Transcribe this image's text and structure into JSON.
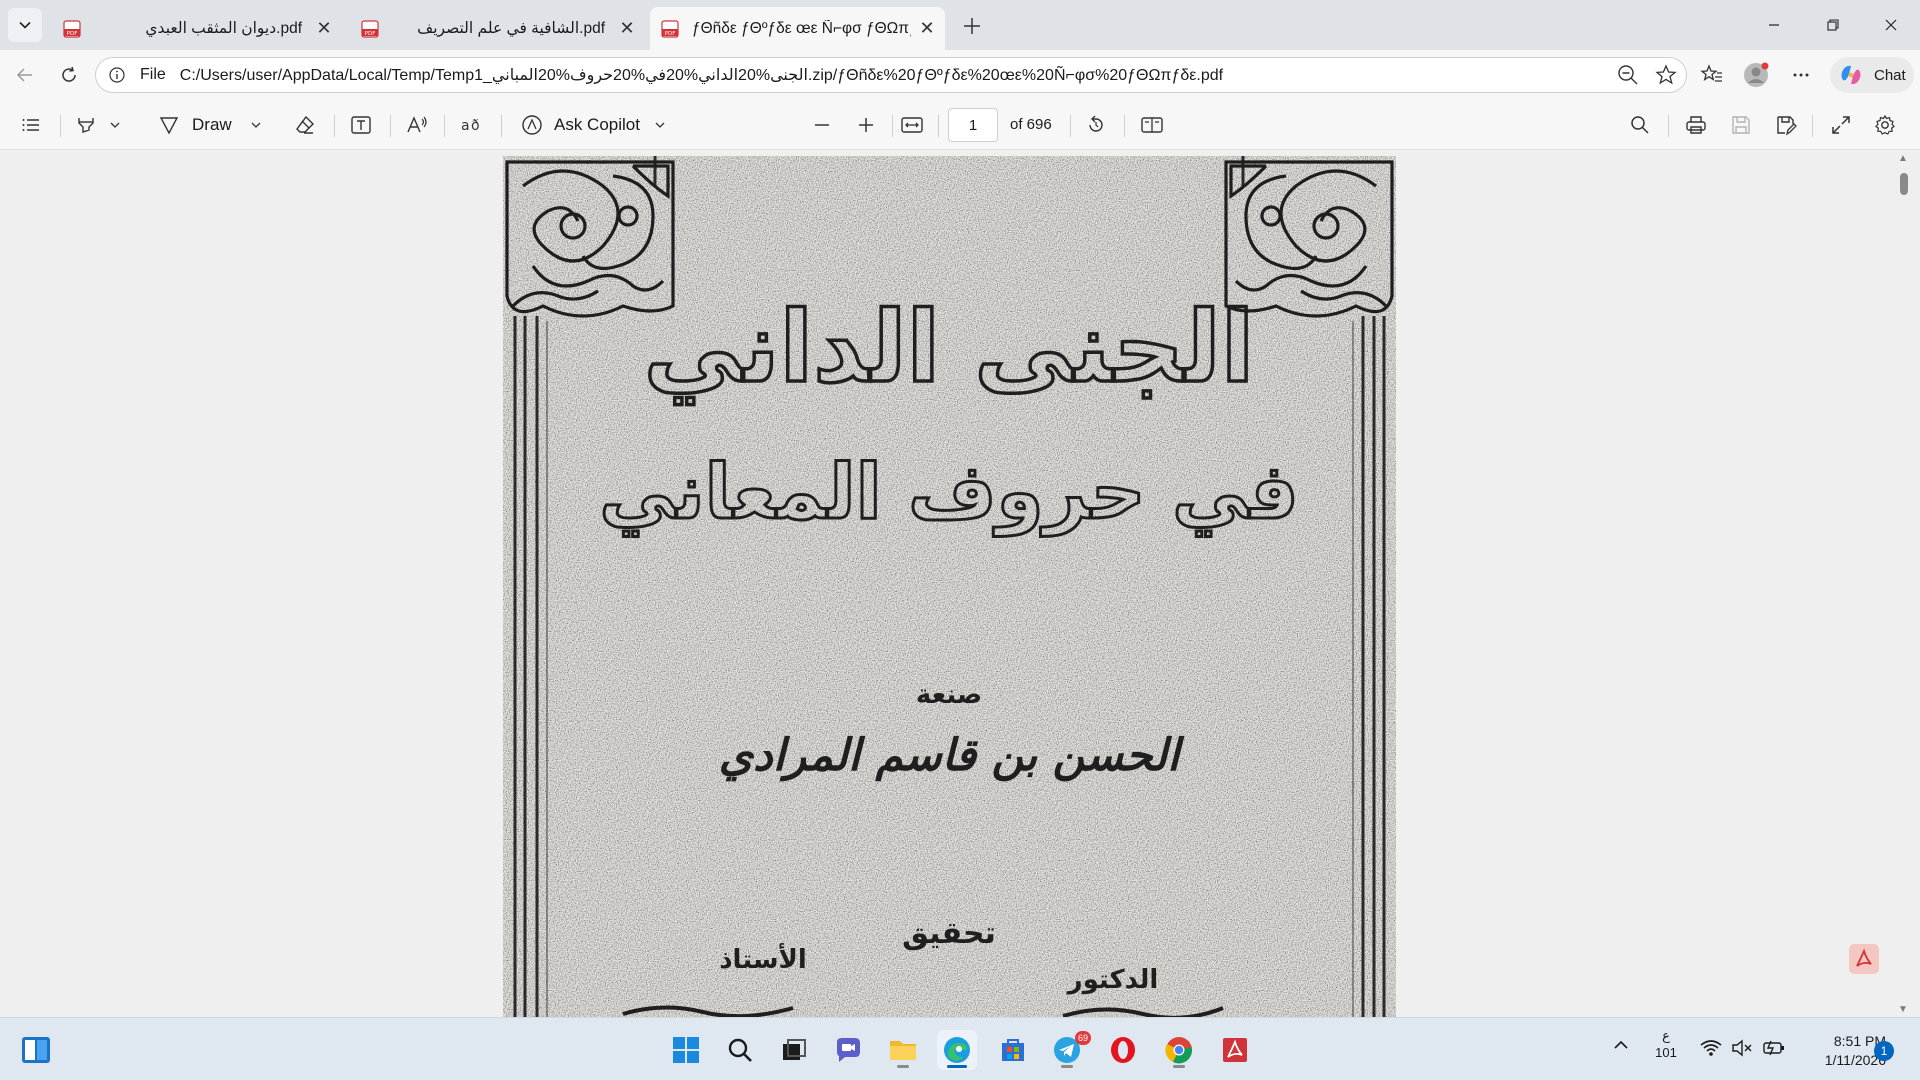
{
  "browser": {
    "tabs": [
      {
        "title": "ديوان المثقب العبدي.pdf",
        "icon": "pdf-icon"
      },
      {
        "title": "الشافية في علم التصريف.pdf",
        "icon": "pdf-icon"
      },
      {
        "title": "ƒΘñδε ƒΘºƒδε œε Ñ⌐φσ ƒΘΩπƒδε",
        "icon": "pdf-icon",
        "active": true
      }
    ],
    "address": {
      "scheme_label": "File",
      "url": "C:/Users/user/AppData/Local/Temp/Temp1_الجنى%20الداني%20في%20حروف%20المباني.zip/ƒΘñδε%20ƒΘºƒδε%20œε%20Ñ⌐φσ%20ƒΘΩπƒδε.pdf"
    },
    "chat_label": "Chat"
  },
  "pdf_toolbar": {
    "draw_label": "Draw",
    "copilot_label": "Ask Copilot",
    "page_number": "1",
    "page_total": "of 696"
  },
  "document": {
    "title_line1": "الجنى الداني",
    "title_line2": "في حروف المعاني",
    "author_prefix": "صنعة",
    "author": "الحسن بن قاسم المرادي",
    "editing_label": "تحقيق",
    "editor_right_title": "الدكتور",
    "editor_left_title": "الأستاذ"
  },
  "taskbar": {
    "apps": [
      "windows-start",
      "search",
      "task-view",
      "chat-meet",
      "file-explorer",
      "edge",
      "store",
      "telegram",
      "opera",
      "chrome",
      "acrobat"
    ],
    "telegram_badge": "69",
    "keyboard_lang": "ع",
    "keyboard_sub": "101",
    "time": "8:51 PM",
    "date": "1/11/2026",
    "notifications": "1"
  },
  "colors": {
    "accent": "#0067c0",
    "pdf_red": "#d13438",
    "titlebar": "#dfe3e8",
    "toolbar": "#f7f7f7"
  }
}
